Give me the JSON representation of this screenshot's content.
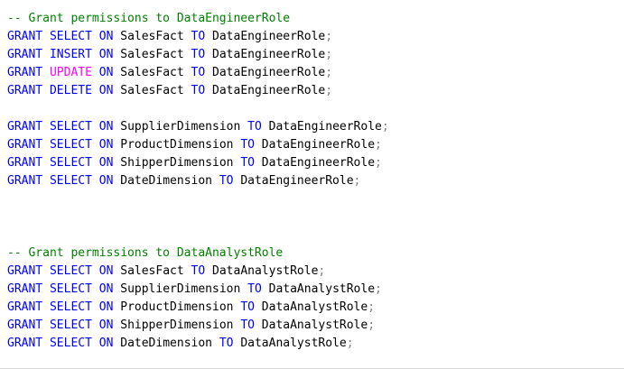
{
  "colors": {
    "keyword": "#0000ff",
    "keyword_update": "#ff00ff",
    "identifier": "#000000",
    "punctuation": "#808080",
    "comment": "#008000",
    "background": "#ffffff"
  },
  "editor": {
    "lines": [
      {
        "type": "comment",
        "text": "-- Grant permissions to DataEngineerRole"
      },
      {
        "type": "grant",
        "grant": "GRANT",
        "privilege": "SELECT",
        "on": "ON",
        "object": "SalesFact",
        "to": "TO",
        "role": "DataEngineerRole",
        "semicolon": ";"
      },
      {
        "type": "grant",
        "grant": "GRANT",
        "privilege": "INSERT",
        "on": "ON",
        "object": "SalesFact",
        "to": "TO",
        "role": "DataEngineerRole",
        "semicolon": ";"
      },
      {
        "type": "grant",
        "grant": "GRANT",
        "privilege": "UPDATE",
        "on": "ON",
        "object": "SalesFact",
        "to": "TO",
        "role": "DataEngineerRole",
        "semicolon": ";"
      },
      {
        "type": "grant",
        "grant": "GRANT",
        "privilege": "DELETE",
        "on": "ON",
        "object": "SalesFact",
        "to": "TO",
        "role": "DataEngineerRole",
        "semicolon": ";"
      },
      {
        "type": "blank",
        "text": ""
      },
      {
        "type": "grant",
        "grant": "GRANT",
        "privilege": "SELECT",
        "on": "ON",
        "object": "SupplierDimension",
        "to": "TO",
        "role": "DataEngineerRole",
        "semicolon": ";"
      },
      {
        "type": "grant",
        "grant": "GRANT",
        "privilege": "SELECT",
        "on": "ON",
        "object": "ProductDimension",
        "to": "TO",
        "role": "DataEngineerRole",
        "semicolon": ";"
      },
      {
        "type": "grant",
        "grant": "GRANT",
        "privilege": "SELECT",
        "on": "ON",
        "object": "ShipperDimension",
        "to": "TO",
        "role": "DataEngineerRole",
        "semicolon": ";"
      },
      {
        "type": "grant",
        "grant": "GRANT",
        "privilege": "SELECT",
        "on": "ON",
        "object": "DateDimension",
        "to": "TO",
        "role": "DataEngineerRole",
        "semicolon": ";"
      },
      {
        "type": "blank",
        "text": ""
      },
      {
        "type": "blank",
        "text": ""
      },
      {
        "type": "blank",
        "text": ""
      },
      {
        "type": "comment",
        "text": "-- Grant permissions to DataAnalystRole"
      },
      {
        "type": "grant",
        "grant": "GRANT",
        "privilege": "SELECT",
        "on": "ON",
        "object": "SalesFact",
        "to": "TO",
        "role": "DataAnalystRole",
        "semicolon": ";"
      },
      {
        "type": "grant",
        "grant": "GRANT",
        "privilege": "SELECT",
        "on": "ON",
        "object": "SupplierDimension",
        "to": "TO",
        "role": "DataAnalystRole",
        "semicolon": ";"
      },
      {
        "type": "grant",
        "grant": "GRANT",
        "privilege": "SELECT",
        "on": "ON",
        "object": "ProductDimension",
        "to": "TO",
        "role": "DataAnalystRole",
        "semicolon": ";"
      },
      {
        "type": "grant",
        "grant": "GRANT",
        "privilege": "SELECT",
        "on": "ON",
        "object": "ShipperDimension",
        "to": "TO",
        "role": "DataAnalystRole",
        "semicolon": ";"
      },
      {
        "type": "grant",
        "grant": "GRANT",
        "privilege": "SELECT",
        "on": "ON",
        "object": "DateDimension",
        "to": "TO",
        "role": "DataAnalystRole",
        "semicolon": ";"
      }
    ]
  }
}
